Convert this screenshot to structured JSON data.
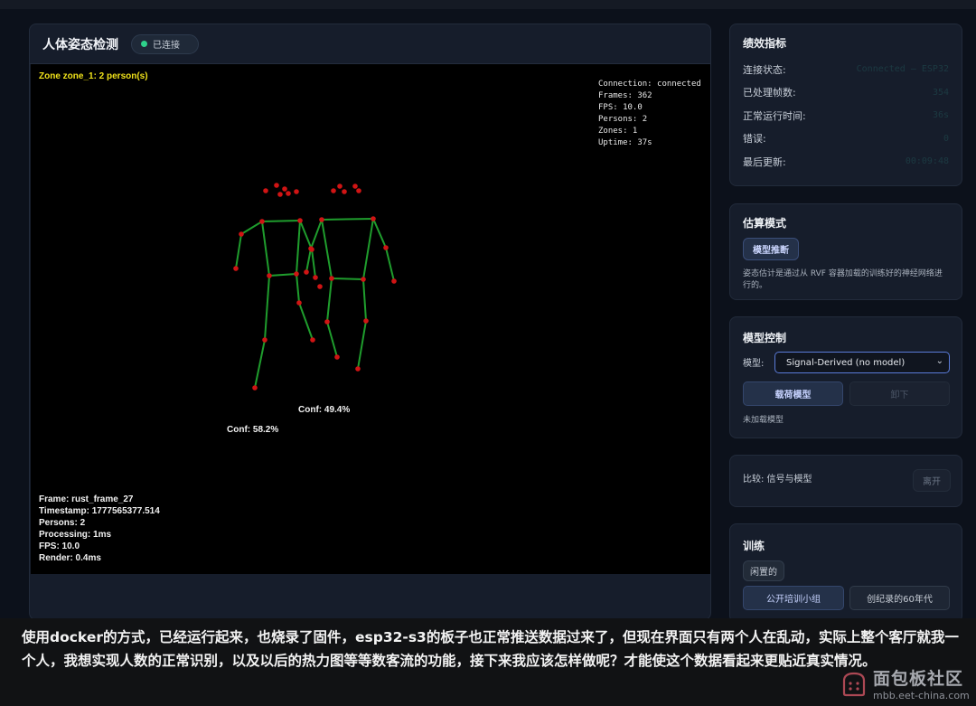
{
  "panel": {
    "title": "人体姿态检测",
    "status": "已连接",
    "zone_label": "Zone zone_1: 2 person(s)",
    "stats_top_right": [
      "Connection: connected",
      "Frames: 362",
      "FPS: 10.0",
      "Persons: 2",
      "Zones: 1",
      "Uptime: 37s"
    ],
    "stats_bottom_left": [
      "Frame: rust_frame_27",
      "Timestamp: 1777565377.514",
      "Persons: 2",
      "Processing: 1ms",
      "FPS: 10.0",
      "Render: 0.4ms"
    ],
    "persons": [
      {
        "conf_label": "Conf: 58.2%"
      },
      {
        "conf_label": "Conf: 49.4%"
      }
    ],
    "colors": {
      "bone": "#1f9d2d",
      "joint": "#d01414",
      "zone_text": "#f0e21a"
    }
  },
  "metrics": {
    "title": "绩效指标",
    "rows": [
      {
        "label": "连接状态:",
        "value": "Connected — ESP32"
      },
      {
        "label": "已处理帧数:",
        "value": "354"
      },
      {
        "label": "正常运行时间:",
        "value": "36s"
      },
      {
        "label": "错误:",
        "value": "0"
      },
      {
        "label": "最后更新:",
        "value": "00:09:48"
      }
    ]
  },
  "estimation": {
    "title": "估算模式",
    "mode": "模型推断",
    "description": "姿态估计是通过从 RVF 容器加载的训练好的神经网络进行的。"
  },
  "model_control": {
    "title": "模型控制",
    "model_label": "模型:",
    "selected": "Signal-Derived (no model)",
    "load_button": "载荷模型",
    "unload_button": "卸下",
    "status": "未加载模型"
  },
  "compare": {
    "label": "比较: 信号与模型",
    "toggle": "离开"
  },
  "training": {
    "title": "训练",
    "state": "闲置的",
    "btn_primary": "公开培训小组",
    "btn_secondary": "创纪录的60年代"
  },
  "caption": "使用docker的方式，已经运行起来，也烧录了固件，esp32-s3的板子也正常推送数据过来了，但现在界面只有两个人在乱动，实际上整个客厅就我一个人，我想实现人数的正常识别，以及以后的热力图等等数客流的功能，接下来我应该怎样做呢？才能使这个数据看起来更贴近真实情况。",
  "watermark": {
    "title": "面包板社区",
    "url": "mbb.eet-china.com"
  }
}
